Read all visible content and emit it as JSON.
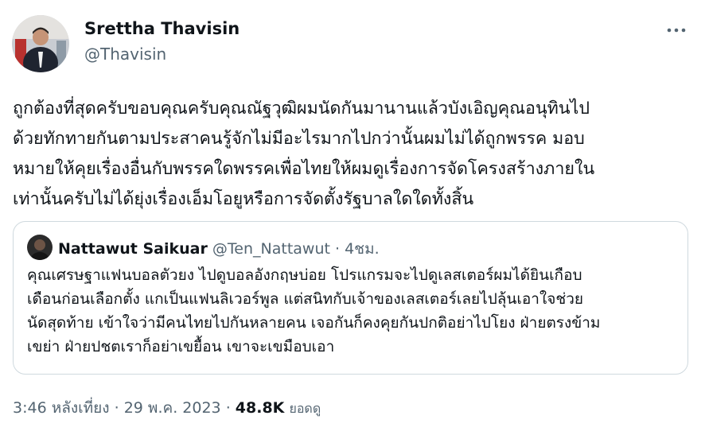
{
  "author": {
    "name": "Srettha Thavisin",
    "handle": "@Thavisin"
  },
  "more_icon": "more-horizontal-icon",
  "tweet_lines": [
    "ถูกต้องที่สุดครับขอบคุณครับคุณณัฐวุฒิผมนัดกันมานานแล้วบังเอิญคุณอนุทินไป",
    "ด้วยทักทายกันตามประสาคนรู้จักไม่มีอะไรมากไปกว่านั้นผมไม่ได้ถูกพรรค มอบ",
    "หมายให้คุยเรื่องอื่นกับพรรคใดพรรคเพื่อไทยให้ผมดูเรื่องการจัดโครงสร้างภายใน",
    "เท่านั้นครับไม่ได้ยุ่งเรื่องเอ็มโอยูหรือการจัดตั้งรัฐบาลใดใดทั้งสิ้น"
  ],
  "quote": {
    "name": "Nattawut Saikuar",
    "handle": "@Ten_Nattawut",
    "separator": "·",
    "time": "4ชม.",
    "lines": [
      "คุณเศรษฐาแฟนบอลตัวยง ไปดูบอลอังกฤษบ่อย โปรแกรมจะไปดูเลสเตอร์ผมได้ยินเกือบ",
      "เดือนก่อนเลือกตั้ง แกเป็นแฟนลิเวอร์พูล แต่สนิทกับเจ้าของเลสเตอร์เลยไปลุ้นเอาใจช่วย",
      "นัดสุดท้าย เข้าใจว่ามีคนไทยไปกันหลายคน เจอกันก็คงคุยกันปกติอย่าไปโยง ฝ่ายตรงข้าม",
      "เขย่า ฝ่ายปชตเราก็อย่าเขยื้อน เขาจะเขมือบเอา"
    ]
  },
  "meta": {
    "time": "3:46 หลังเที่ยง",
    "sep1": " · ",
    "date": "29 พ.ค. 2023",
    "sep2": " · ",
    "views_count": "48.8K",
    "views_label": "ยอดดู"
  },
  "colors": {
    "text_primary": "#0f1419",
    "text_secondary": "#536471",
    "border": "#cfd9de"
  }
}
